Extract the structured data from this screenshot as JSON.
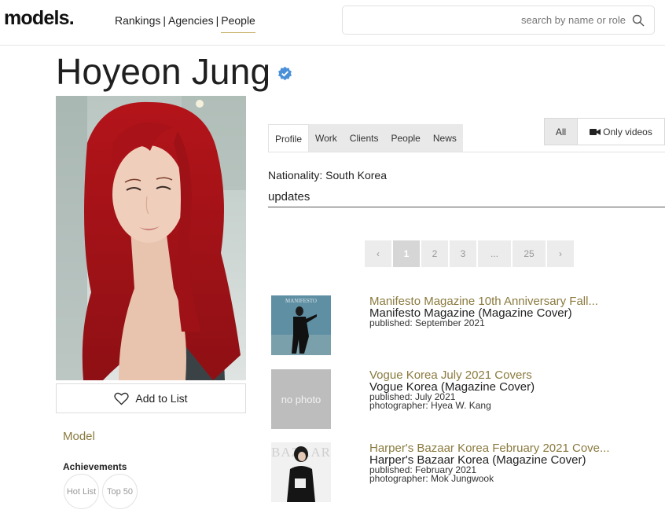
{
  "header": {
    "logo": "models.",
    "nav": [
      {
        "label": "Rankings"
      },
      {
        "label": "Agencies"
      },
      {
        "label": "People",
        "active": true
      }
    ],
    "search_placeholder": "search by name or role",
    "search_icon": "search-icon"
  },
  "profile": {
    "name": "Hoyeon Jung",
    "verified_icon": "verified-check-icon",
    "add_to_list": "Add to List",
    "role": "Model",
    "achievements_title": "Achievements",
    "badges": [
      "Hot List",
      "Top 50"
    ]
  },
  "tabs": [
    {
      "label": "Profile",
      "active": true
    },
    {
      "label": "Work"
    },
    {
      "label": "Clients"
    },
    {
      "label": "People"
    },
    {
      "label": "News"
    }
  ],
  "filter": {
    "all_label": "All",
    "videos_label": "Only videos",
    "videos_icon": "video-camera-icon"
  },
  "details": {
    "nationality": "Nationality: South Korea",
    "updates_heading": "updates"
  },
  "pagination": {
    "prev": "‹",
    "pages": [
      "1",
      "2",
      "3",
      "...",
      "25"
    ],
    "current": "1",
    "next": "›"
  },
  "updates": [
    {
      "title": "Manifesto Magazine 10th Anniversary Fall...",
      "publication": "Manifesto Magazine (Magazine Cover)",
      "published": "published: September 2021",
      "photographer": "",
      "thumb_text": "MANIFESTO"
    },
    {
      "title": "Vogue Korea July 2021 Covers",
      "publication": "Vogue Korea (Magazine Cover)",
      "published": "published: July 2021",
      "photographer": "photographer: Hyea W. Kang",
      "thumb_text": "no photo"
    },
    {
      "title": "Harper's Bazaar Korea February 2021 Cove...",
      "publication": "Harper's Bazaar Korea (Magazine Cover)",
      "published": "published: February 2021",
      "photographer": "photographer: Mok Jungwook",
      "thumb_text": "BAZAAR"
    }
  ],
  "colors": {
    "accent_gold": "#8a7a3e",
    "verified_blue": "#4a90d9",
    "hair_red": "#b0161b"
  }
}
